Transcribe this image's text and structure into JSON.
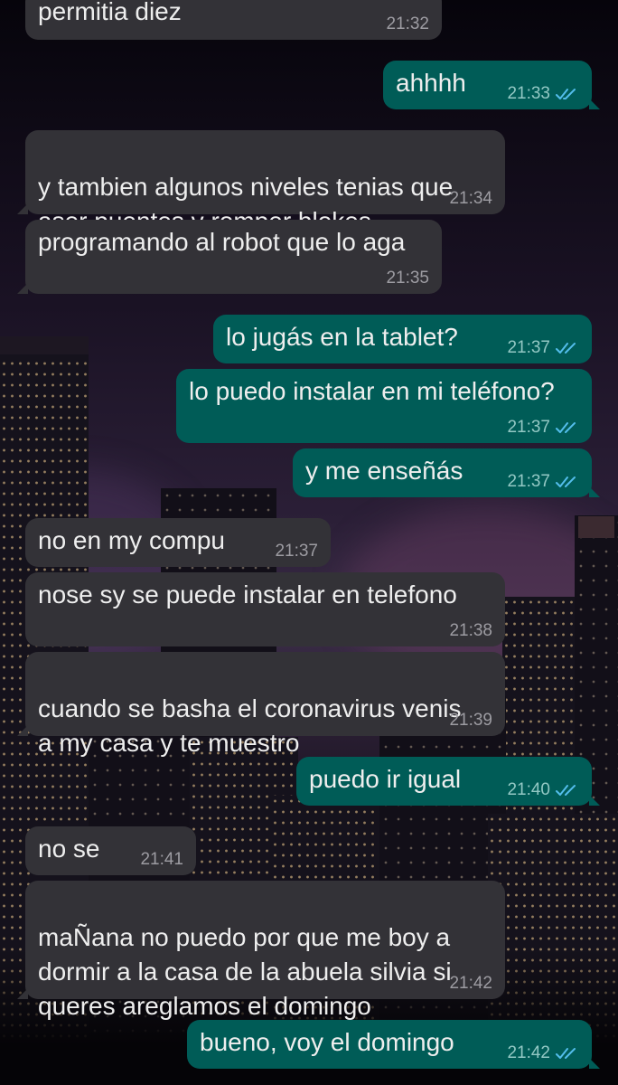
{
  "colors": {
    "incoming_bubble": "#333237",
    "outgoing_bubble": "#005c57",
    "read_ticks": "#53bdeb",
    "timestamp": "#9d9ca2"
  },
  "messages": [
    {
      "direction": "in",
      "text": "permitia diez",
      "time": "21:32"
    },
    {
      "direction": "out",
      "text": "ahhhh",
      "time": "21:33",
      "status": "read"
    },
    {
      "direction": "in",
      "text": "y tambien algunos niveles tenias que\naser puentes y romper blokes",
      "time": "21:34"
    },
    {
      "direction": "in",
      "text": "programando al robot que lo aga",
      "time": "21:35"
    },
    {
      "direction": "out",
      "text": "lo jugás en la tablet?",
      "time": "21:37",
      "status": "read"
    },
    {
      "direction": "out",
      "text": "lo puedo instalar en mi teléfono?",
      "time": "21:37",
      "status": "read"
    },
    {
      "direction": "out",
      "text": "y me enseñás",
      "time": "21:37",
      "status": "read"
    },
    {
      "direction": "in",
      "text": "no en my compu",
      "time": "21:37"
    },
    {
      "direction": "in",
      "text": "nose sy se puede instalar en telefono",
      "time": "21:38"
    },
    {
      "direction": "in",
      "text": "cuando se basha el coronavirus venis\na my casa y te muestro",
      "time": "21:39"
    },
    {
      "direction": "out",
      "text": "puedo ir igual",
      "time": "21:40",
      "status": "read"
    },
    {
      "direction": "in",
      "text": "no se",
      "time": "21:41"
    },
    {
      "direction": "in",
      "text": "maÑana no puedo por que me boy a\ndormir a la casa de la abuela silvia si\nqueres areglamos el domingo",
      "time": "21:42"
    },
    {
      "direction": "out",
      "text": "bueno, voy el domingo",
      "time": "21:42",
      "status": "read"
    }
  ]
}
